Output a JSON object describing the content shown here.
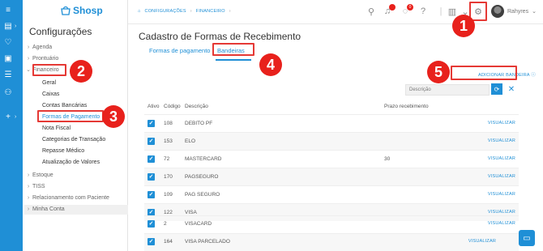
{
  "app": {
    "logo_text": "Shosp",
    "brand_color": "#1f8fd6",
    "annotation_color": "#e8211c"
  },
  "rail": {
    "icons": [
      "menu-icon",
      "calendar-icon",
      "heart-icon",
      "dollar-icon",
      "database-icon",
      "users-icon",
      "plus-icon"
    ]
  },
  "sidebar": {
    "title": "Configurações",
    "items": [
      {
        "label": "Agenda"
      },
      {
        "label": "Prontuário"
      },
      {
        "label": "Financeiro"
      },
      {
        "label": "Estoque"
      },
      {
        "label": "TISS"
      },
      {
        "label": "Relacionamento com Paciente"
      },
      {
        "label": "Minha Conta"
      }
    ],
    "financeiro_children": [
      {
        "label": "Geral"
      },
      {
        "label": "Caixas"
      },
      {
        "label": "Contas Bancárias"
      },
      {
        "label": "Formas de Pagamento"
      },
      {
        "label": "Nota Fiscal"
      },
      {
        "label": "Categorias de Transação"
      },
      {
        "label": "Repasse Médico"
      },
      {
        "label": "Atualização de Valores"
      }
    ]
  },
  "topbar": {
    "breadcrumb": [
      "CONFIGURAÇÕES",
      "FINANCEIRO"
    ],
    "notification_count": "0",
    "user_name": "Rahyres"
  },
  "main": {
    "title": "Cadastro de Formas de Recebimento",
    "tabs": [
      {
        "label": "Formas de pagamento"
      },
      {
        "label": "Bandeiras"
      }
    ],
    "add_button": "ADICIONAR BANDEIRA",
    "search_placeholder": "Descrição",
    "columns": [
      "Ativo",
      "Código",
      "Descrição",
      "Prazo recebimento"
    ],
    "view_label": "VISUALIZAR",
    "rows": [
      {
        "code": "108",
        "desc": "DEBITO PF",
        "prazo": ""
      },
      {
        "code": "153",
        "desc": "ELO",
        "prazo": ""
      },
      {
        "code": "72",
        "desc": "MASTERCARD",
        "prazo": "30"
      },
      {
        "code": "170",
        "desc": "PAGSEGURO",
        "prazo": ""
      },
      {
        "code": "109",
        "desc": "PAG SEGURO",
        "prazo": ""
      },
      {
        "code": "122",
        "desc": "VISA",
        "prazo": ""
      },
      {
        "code": "2",
        "desc": "VISACARD",
        "prazo": ""
      },
      {
        "code": "164",
        "desc": "VISA PARCELADO",
        "prazo": ""
      }
    ]
  },
  "annotations": [
    "1",
    "2",
    "3",
    "4",
    "5"
  ]
}
